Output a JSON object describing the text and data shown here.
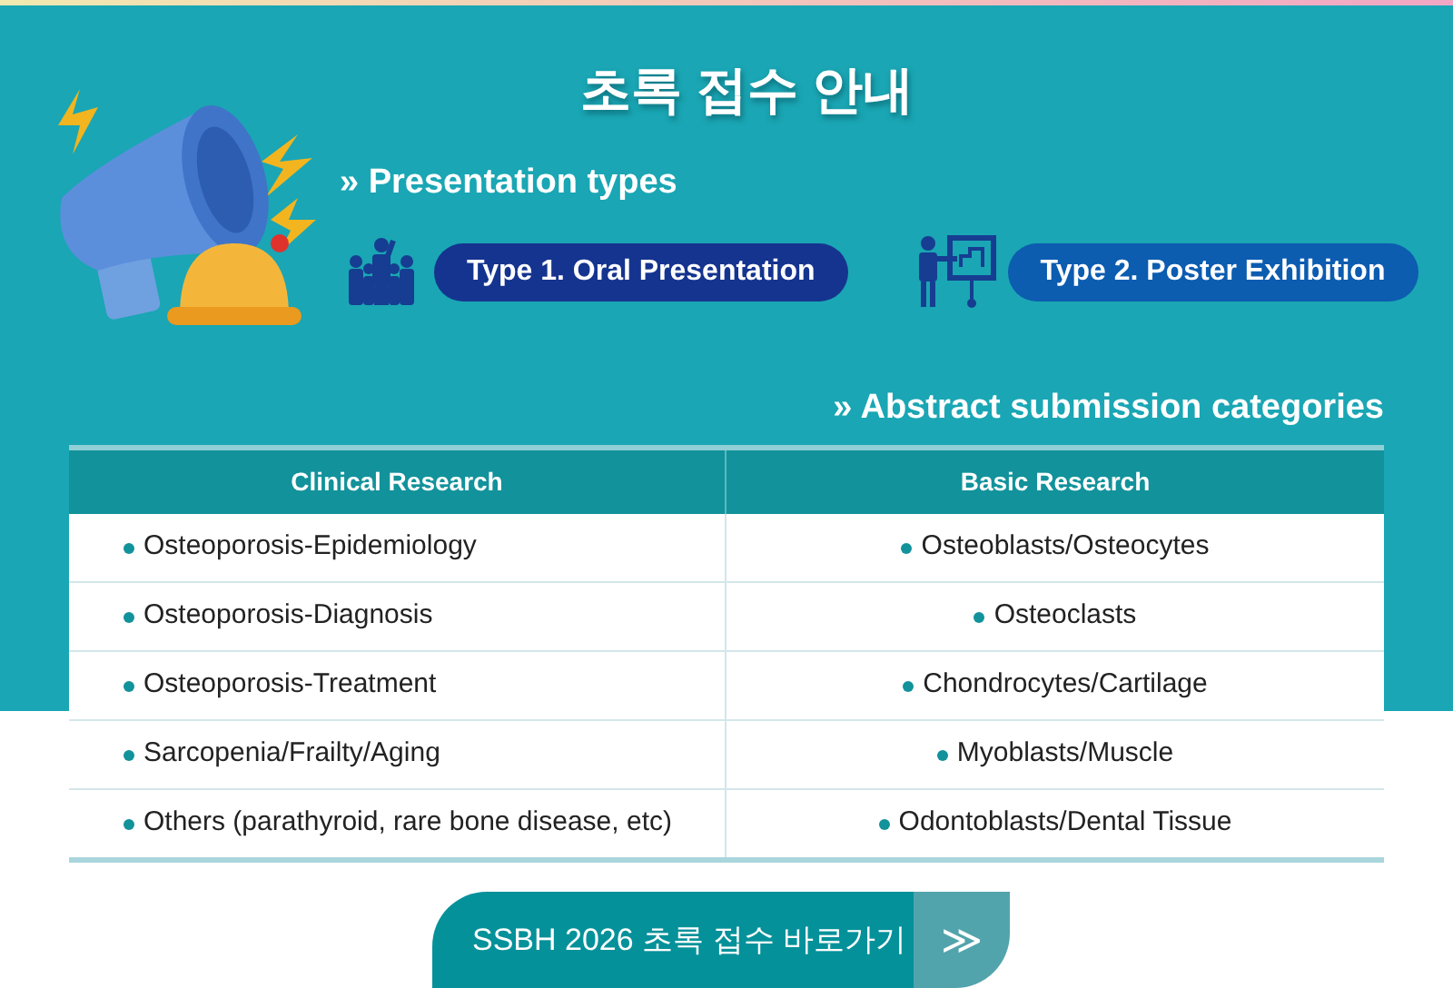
{
  "title": "초록 접수 안내",
  "presentation_heading": "» Presentation types",
  "presentation_types": [
    {
      "kind": "oral",
      "label": "Type 1. Oral Presentation",
      "color": "#15348f"
    },
    {
      "kind": "poster",
      "label": "Type 2. Poster Exhibition",
      "color": "#0c5cb0"
    }
  ],
  "categories_heading": "» Abstract submission categories",
  "table": {
    "columns": [
      "Clinical Research",
      "Basic Research"
    ],
    "rows": [
      [
        "Osteoporosis-Epidemiology",
        "Osteoblasts/Osteocytes"
      ],
      [
        "Osteoporosis-Diagnosis",
        "Osteoclasts"
      ],
      [
        "Osteoporosis-Treatment",
        "Chondrocytes/Cartilage"
      ],
      [
        "Sarcopenia/Frailty/Aging",
        "Myoblasts/Muscle"
      ],
      [
        "Others (parathyroid, rare bone disease, etc)",
        "Odontoblasts/Dental Tissue"
      ]
    ]
  },
  "submit_button": {
    "label": "SSBH 2026 초록 접수 바로가기",
    "arrow": "≫"
  }
}
